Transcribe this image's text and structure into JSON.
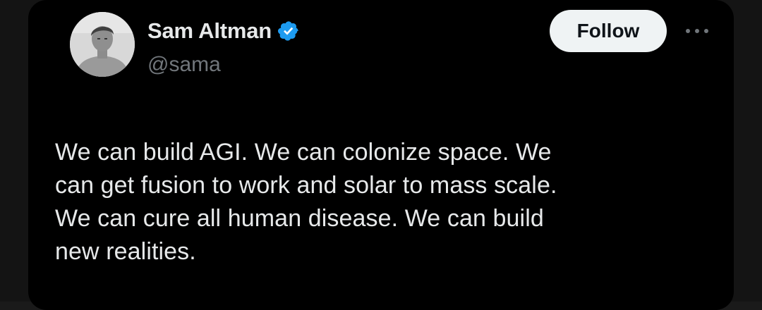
{
  "author": {
    "display_name": "Sam Altman",
    "handle": "@sama",
    "verified": true,
    "avatar_icon": "profile-photo"
  },
  "actions": {
    "follow_label": "Follow",
    "more_icon": "more-horizontal-icon"
  },
  "tweet": {
    "text": "We can build AGI. We can colonize space. We\ncan get fusion to work and solar to mass scale.\nWe can cure all human disease. We can build\nnew realities."
  },
  "colors": {
    "background": "#000000",
    "primary_text": "#e7e9ea",
    "secondary_text": "#71767b",
    "verified_badge": "#1d9bf0",
    "follow_button_bg": "#eff3f4",
    "follow_button_text": "#0f1419"
  }
}
